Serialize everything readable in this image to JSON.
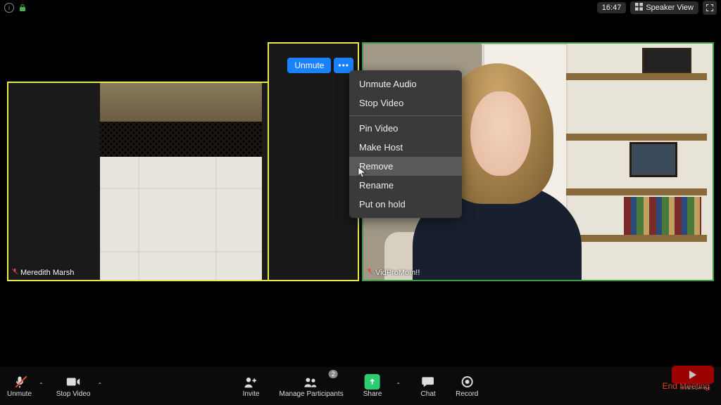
{
  "topbar": {
    "timer": "16:47",
    "view_label": "Speaker View"
  },
  "tiles": {
    "tile1_name": "Meredith Marsh",
    "tile3_name": "VidProMom!!"
  },
  "tile_buttons": {
    "unmute": "Unmute",
    "more": "•••"
  },
  "context_menu": {
    "unmute_audio": "Unmute Audio",
    "stop_video": "Stop Video",
    "pin_video": "Pin Video",
    "make_host": "Make Host",
    "remove": "Remove",
    "rename": "Rename",
    "put_on_hold": "Put on hold"
  },
  "toolbar": {
    "unmute": "Unmute",
    "stop_video": "Stop Video",
    "invite": "Invite",
    "manage_participants": "Manage Participants",
    "participants_count": "2",
    "share": "Share",
    "chat": "Chat",
    "record": "Record",
    "end_meeting": "End Meeting"
  },
  "overlay": {
    "subscribe": "SUBSCRIBE"
  }
}
